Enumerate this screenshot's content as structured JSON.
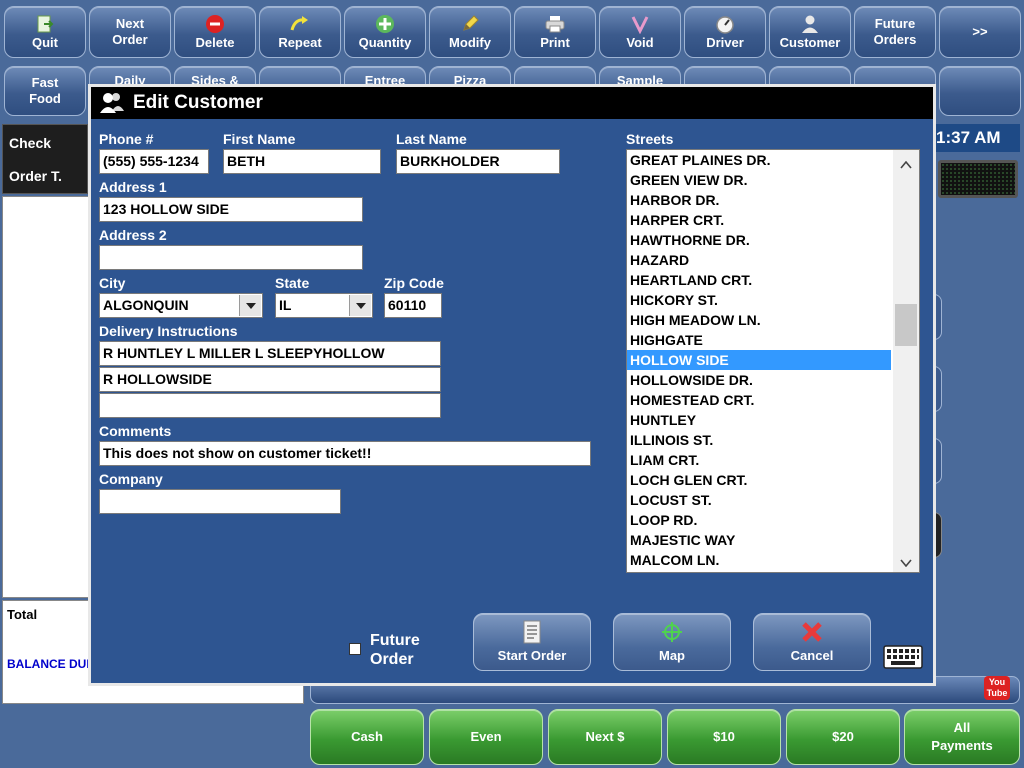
{
  "toolbar_top": [
    {
      "label": "Quit",
      "icon": "exit-icon"
    },
    {
      "label": "Next\nOrder",
      "icon": ""
    },
    {
      "label": "Delete",
      "icon": "delete-icon"
    },
    {
      "label": "Repeat",
      "icon": "repeat-icon"
    },
    {
      "label": "Quantity",
      "icon": "plus-icon"
    },
    {
      "label": "Modify",
      "icon": "pencil-icon"
    },
    {
      "label": "Print",
      "icon": "printer-icon"
    },
    {
      "label": "Void",
      "icon": "void-icon"
    },
    {
      "label": "Driver",
      "icon": "speedometer-icon"
    },
    {
      "label": "Customer",
      "icon": "person-icon"
    },
    {
      "label": "Future\nOrders",
      "icon": ""
    },
    {
      "label": ">>",
      "icon": ""
    }
  ],
  "toolbar_bottom": [
    {
      "label": "Fast\nFood"
    },
    {
      "label": "Daily"
    },
    {
      "label": "Sides &"
    },
    {
      "label": ""
    },
    {
      "label": "Entree"
    },
    {
      "label": "Pizza"
    },
    {
      "label": ""
    },
    {
      "label": "Sample"
    },
    {
      "label": ""
    },
    {
      "label": ""
    },
    {
      "label": ""
    },
    {
      "label": ""
    }
  ],
  "left_panel": {
    "check_label": "Check",
    "order_label": "Order T.",
    "total_label": "Total",
    "balance_label": "BALANCE DUE"
  },
  "clock_text": "1:37 AM",
  "youtube_label": "You\nTube",
  "payment_buttons": [
    "Cash",
    "Even",
    "Next $",
    "$10",
    "$20",
    "All\nPayments"
  ],
  "colors": {
    "background": "#4a6a9a",
    "dialog_bg": "#2e5591",
    "title_bar": "#000000",
    "selection": "#3399ff",
    "payment_green": "#3a9a32",
    "balance_text": "#0000cc"
  },
  "dialog": {
    "title": "Edit Customer",
    "labels": {
      "phone": "Phone #",
      "first_name": "First Name",
      "last_name": "Last Name",
      "address1": "Address 1",
      "address2": "Address 2",
      "city": "City",
      "state": "State",
      "zip": "Zip Code",
      "delivery": "Delivery Instructions",
      "comments": "Comments",
      "company": "Company",
      "streets": "Streets"
    },
    "values": {
      "phone": "(555) 555-1234",
      "first_name": "BETH",
      "last_name": "BURKHOLDER",
      "address1": "123  HOLLOW SIDE",
      "address2": "",
      "city": "ALGONQUIN",
      "state": "IL",
      "zip": "60110",
      "delivery1": "R HUNTLEY L MILLER L SLEEPYHOLLOW",
      "delivery2": "R HOLLOWSIDE",
      "delivery3": "",
      "comments": "This does not show on customer ticket!!",
      "company": ""
    },
    "streets": [
      "GREAT PLAINES DR.",
      "GREEN VIEW DR.",
      "HARBOR DR.",
      "HARPER CRT.",
      "HAWTHORNE DR.",
      "HAZARD",
      "HEARTLAND CRT.",
      "HICKORY ST.",
      "HIGH MEADOW LN.",
      "HIGHGATE",
      "HOLLOW SIDE",
      "HOLLOWSIDE DR.",
      "HOMESTEAD CRT.",
      "HUNTLEY",
      "ILLINOIS ST.",
      "LIAM CRT.",
      "LOCH GLEN CRT.",
      "LOCUST ST.",
      "LOOP RD.",
      "MAJESTIC WAY",
      "MALCOM LN."
    ],
    "selected_street": "HOLLOW SIDE",
    "future_order_label": "Future\nOrder",
    "future_order_checked": false,
    "buttons": {
      "start_order": "Start Order",
      "map": "Map",
      "cancel": "Cancel"
    }
  }
}
